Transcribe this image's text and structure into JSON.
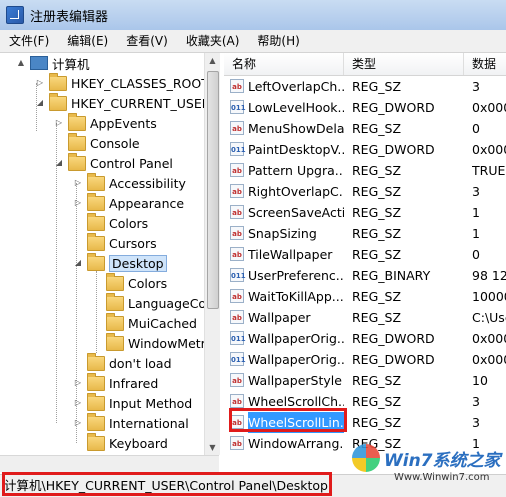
{
  "window": {
    "title": "注册表编辑器"
  },
  "menu": [
    "文件(F)",
    "编辑(E)",
    "查看(V)",
    "收藏夹(A)",
    "帮助(H)"
  ],
  "tree": [
    {
      "label": "计算机",
      "indent": 0,
      "icon": "computer-icon",
      "expander": "▲"
    },
    {
      "label": "HKEY_CLASSES_ROOT",
      "indent": 1,
      "icon": "folder-icon",
      "expander": "▷"
    },
    {
      "label": "HKEY_CURRENT_USER",
      "indent": 1,
      "icon": "folder-icon",
      "expander": "◢"
    },
    {
      "label": "AppEvents",
      "indent": 2,
      "icon": "folder-icon",
      "expander": "▷"
    },
    {
      "label": "Console",
      "indent": 2,
      "icon": "folder-icon",
      "expander": ""
    },
    {
      "label": "Control Panel",
      "indent": 2,
      "icon": "folder-icon",
      "expander": "◢"
    },
    {
      "label": "Accessibility",
      "indent": 3,
      "icon": "folder-icon",
      "expander": "▷"
    },
    {
      "label": "Appearance",
      "indent": 3,
      "icon": "folder-icon",
      "expander": "▷"
    },
    {
      "label": "Colors",
      "indent": 3,
      "icon": "folder-icon",
      "expander": ""
    },
    {
      "label": "Cursors",
      "indent": 3,
      "icon": "folder-icon",
      "expander": ""
    },
    {
      "label": "Desktop",
      "indent": 3,
      "icon": "folder-icon",
      "expander": "◢",
      "selected": true
    },
    {
      "label": "Colors",
      "indent": 4,
      "icon": "folder-icon",
      "expander": ""
    },
    {
      "label": "LanguageCor",
      "indent": 4,
      "icon": "folder-icon",
      "expander": ""
    },
    {
      "label": "MuiCached",
      "indent": 4,
      "icon": "folder-icon",
      "expander": ""
    },
    {
      "label": "WindowMetr",
      "indent": 4,
      "icon": "folder-icon",
      "expander": ""
    },
    {
      "label": "don't load",
      "indent": 3,
      "icon": "folder-icon",
      "expander": ""
    },
    {
      "label": "Infrared",
      "indent": 3,
      "icon": "folder-icon",
      "expander": "▷"
    },
    {
      "label": "Input Method",
      "indent": 3,
      "icon": "folder-icon",
      "expander": "▷"
    },
    {
      "label": "International",
      "indent": 3,
      "icon": "folder-icon",
      "expander": "▷"
    },
    {
      "label": "Keyboard",
      "indent": 3,
      "icon": "folder-icon",
      "expander": ""
    }
  ],
  "list": {
    "headers": {
      "name": "名称",
      "type": "类型",
      "data": "数据"
    },
    "rows": [
      {
        "name": "LeftOverlapCh...",
        "type": "REG_SZ",
        "data": "3",
        "kind": "ab"
      },
      {
        "name": "LowLevelHook...",
        "type": "REG_DWORD",
        "data": "0x000",
        "kind": "bin"
      },
      {
        "name": "MenuShowDelay",
        "type": "REG_SZ",
        "data": "0",
        "kind": "ab"
      },
      {
        "name": "PaintDesktopV...",
        "type": "REG_DWORD",
        "data": "0x000",
        "kind": "bin"
      },
      {
        "name": "Pattern Upgra...",
        "type": "REG_SZ",
        "data": "TRUE",
        "kind": "ab"
      },
      {
        "name": "RightOverlapC...",
        "type": "REG_SZ",
        "data": "3",
        "kind": "ab"
      },
      {
        "name": "ScreenSaveActi...",
        "type": "REG_SZ",
        "data": "1",
        "kind": "ab"
      },
      {
        "name": "SnapSizing",
        "type": "REG_SZ",
        "data": "1",
        "kind": "ab"
      },
      {
        "name": "TileWallpaper",
        "type": "REG_SZ",
        "data": "0",
        "kind": "ab"
      },
      {
        "name": "UserPreferenc...",
        "type": "REG_BINARY",
        "data": "98 12",
        "kind": "bin"
      },
      {
        "name": "WaitToKillApp...",
        "type": "REG_SZ",
        "data": "10000",
        "kind": "ab"
      },
      {
        "name": "Wallpaper",
        "type": "REG_SZ",
        "data": "C:\\Use",
        "kind": "ab"
      },
      {
        "name": "WallpaperOrig...",
        "type": "REG_DWORD",
        "data": "0x000",
        "kind": "bin"
      },
      {
        "name": "WallpaperOrig...",
        "type": "REG_DWORD",
        "data": "0x000",
        "kind": "bin"
      },
      {
        "name": "WallpaperStyle",
        "type": "REG_SZ",
        "data": "10",
        "kind": "ab"
      },
      {
        "name": "WheelScrollCh...",
        "type": "REG_SZ",
        "data": "3",
        "kind": "ab"
      },
      {
        "name": "WheelScrollLin...",
        "type": "REG_SZ",
        "data": "3",
        "kind": "ab",
        "selected": true
      },
      {
        "name": "WindowArrang...",
        "type": "REG_SZ",
        "data": "1",
        "kind": "ab"
      }
    ]
  },
  "statusbar": {
    "path": "计算机\\HKEY_CURRENT_USER\\Control Panel\\Desktop"
  },
  "watermark": {
    "brand": "Win7系统之家",
    "url": "Www.Winwin7.com"
  }
}
